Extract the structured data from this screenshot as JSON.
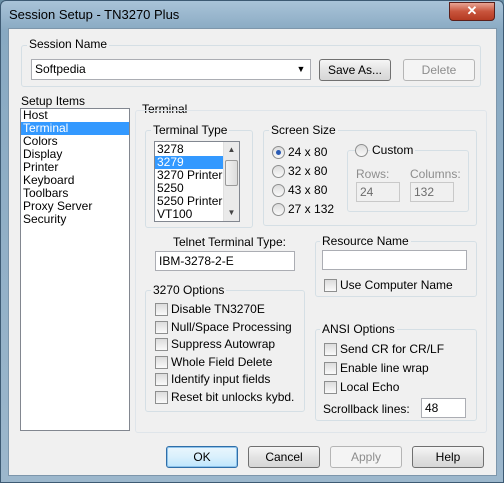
{
  "window": {
    "title": "Session Setup - TN3270 Plus",
    "close_glyph": "✕"
  },
  "session": {
    "label": "Session Name",
    "value": "Softpedia",
    "save_as": "Save As...",
    "delete": "Delete"
  },
  "setup_items": {
    "label": "Setup Items",
    "items": [
      "Host",
      "Terminal",
      "Colors",
      "Display",
      "Printer",
      "Keyboard",
      "Toolbars",
      "Proxy Server",
      "Security"
    ],
    "selected_index": 1
  },
  "terminal": {
    "panel_label": "Terminal",
    "terminal_type": {
      "label": "Terminal Type",
      "items": [
        "3278",
        "3279",
        "3270 Printer",
        "5250",
        "5250 Printer",
        "VT100"
      ],
      "selected_index": 1
    },
    "screen_size": {
      "label": "Screen Size",
      "options": [
        "24 x 80",
        "32 x 80",
        "43 x 80",
        "27 x 132"
      ],
      "selected_index": 0,
      "custom_label": "Custom",
      "rows_label": "Rows:",
      "rows_value": "24",
      "columns_label": "Columns:",
      "columns_value": "132"
    },
    "telnet": {
      "label": "Telnet Terminal Type:",
      "value": "IBM-3278-2-E"
    },
    "resource": {
      "label": "Resource Name",
      "value": "",
      "use_computer_name": "Use Computer Name"
    },
    "options_3270": {
      "label": "3270 Options",
      "items": [
        "Disable TN3270E",
        "Null/Space Processing",
        "Suppress Autowrap",
        "Whole Field Delete",
        "Identify input fields",
        "Reset bit unlocks kybd."
      ]
    },
    "ansi": {
      "label": "ANSI Options",
      "items": [
        "Send CR for CR/LF",
        "Enable line wrap",
        "Local Echo"
      ],
      "scrollback_label": "Scrollback lines:",
      "scrollback_value": "48"
    }
  },
  "buttons": {
    "ok": "OK",
    "cancel": "Cancel",
    "apply": "Apply",
    "help": "Help"
  },
  "colors": {
    "selection": "#3399ff",
    "frame": "#9cb7cc"
  }
}
